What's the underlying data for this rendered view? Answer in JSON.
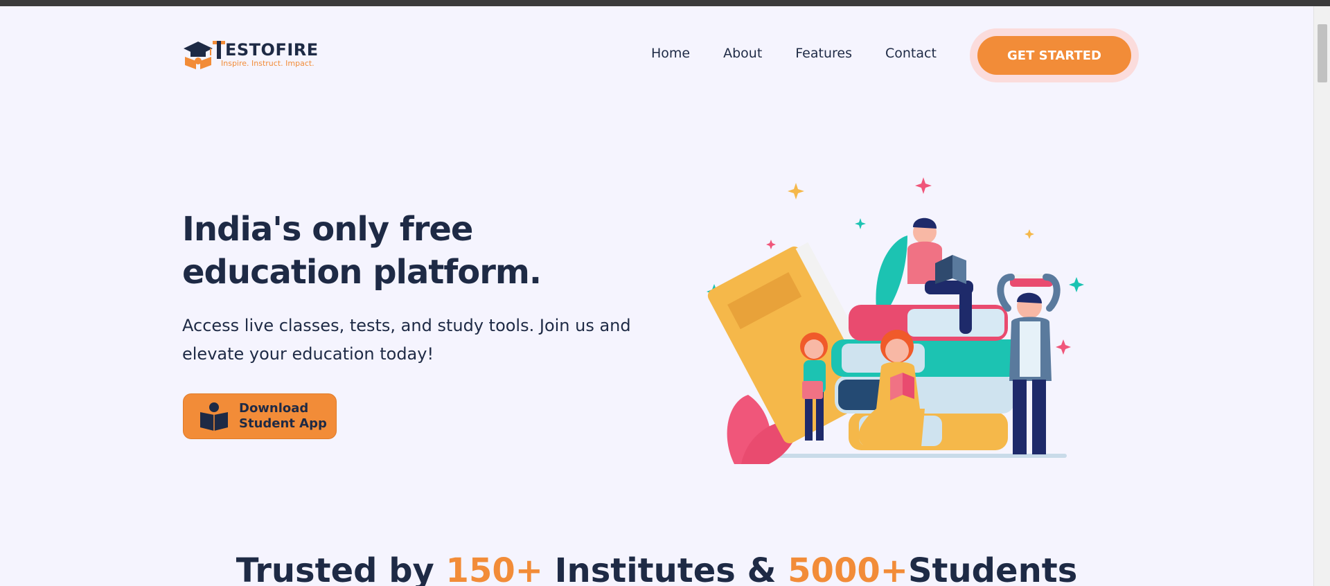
{
  "brand": {
    "name": "ESTOFIRE",
    "tagline": "Inspire. Instruct. Impact.",
    "accent_color": "#f28c38",
    "dark_color": "#1e2a45"
  },
  "nav": {
    "home": "Home",
    "about": "About",
    "features": "Features",
    "contact": "Contact",
    "cta": "GET STARTED"
  },
  "hero": {
    "title_line1": "India's only free",
    "title_line2": "education platform.",
    "subtitle": "Access live classes, tests, and study tools. Join us and elevate your education today!",
    "download_line1": "Download",
    "download_line2": "Student App",
    "illustration": "students-with-books-illustration"
  },
  "trusted": {
    "prefix": "Trusted by ",
    "institutes_count": "150+",
    "middle": " Institutes & ",
    "students_count": "5000+",
    "suffix": "Students"
  }
}
